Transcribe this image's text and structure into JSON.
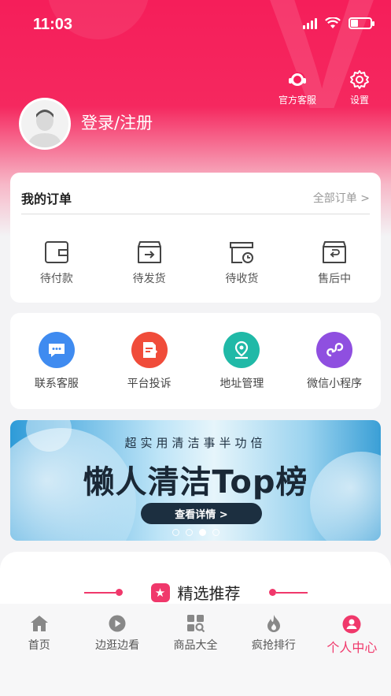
{
  "status_bar": {
    "time": "11:03"
  },
  "header": {
    "customer_service_label": "官方客服",
    "settings_label": "设置",
    "login_label": "登录/注册"
  },
  "orders": {
    "title": "我的订单",
    "all_link": "全部订单 >",
    "items": [
      {
        "label": "待付款",
        "icon": "wallet-icon"
      },
      {
        "label": "待发货",
        "icon": "box-send-icon"
      },
      {
        "label": "待收货",
        "icon": "box-clock-icon"
      },
      {
        "label": "售后中",
        "icon": "box-return-icon"
      }
    ]
  },
  "services": {
    "items": [
      {
        "label": "联系客服",
        "icon": "chat-icon",
        "color": "#3f8bf0"
      },
      {
        "label": "平台投诉",
        "icon": "complaint-icon",
        "color": "#f04c3a"
      },
      {
        "label": "地址管理",
        "icon": "location-icon",
        "color": "#20b9a7"
      },
      {
        "label": "微信小程序",
        "icon": "mini-program-icon",
        "color": "#8f4fe0"
      }
    ]
  },
  "banner": {
    "subtitle": "超实用清洁事半功倍",
    "title": "懒人清洁Top榜",
    "button": "查看详情 >",
    "slide_count": 4,
    "active_slide": 3
  },
  "recommend": {
    "title": "精选推荐"
  },
  "tabbar": {
    "items": [
      {
        "label": "首页",
        "icon": "home-icon"
      },
      {
        "label": "边逛边看",
        "icon": "play-icon"
      },
      {
        "label": "商品大全",
        "icon": "grid-search-icon"
      },
      {
        "label": "疯抢排行",
        "icon": "flame-icon"
      },
      {
        "label": "个人中心",
        "icon": "person-icon",
        "active": true
      }
    ]
  },
  "colors": {
    "brand": "#f51e5a",
    "accent": "#f0386b"
  }
}
